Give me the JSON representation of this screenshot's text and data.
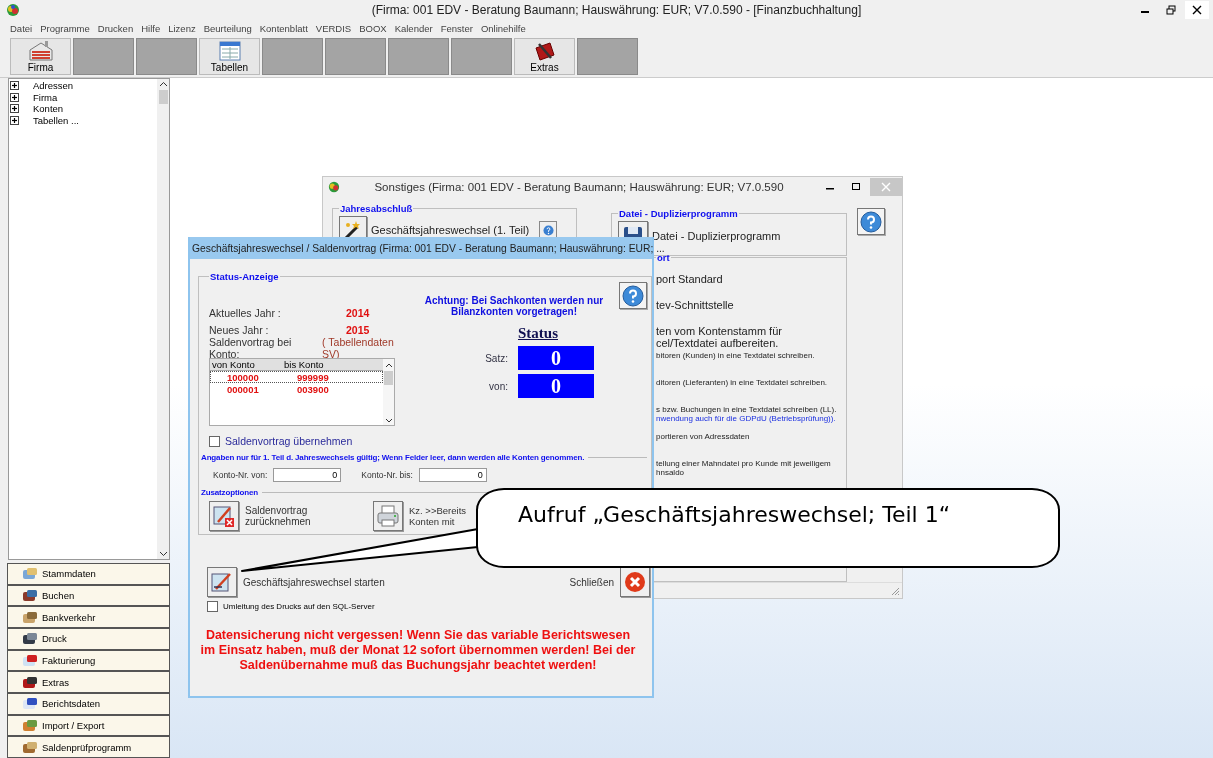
{
  "window": {
    "title": "(Firma: 001 EDV - Beratung Baumann;  Hauswährung: EUR; V7.0.590 - [Finanzbuchhaltung]"
  },
  "menu": [
    "Datei",
    "Programme",
    "Drucken",
    "Hilfe",
    "Lizenz",
    "Beurteilung",
    "Kontenblatt",
    "VERDIS",
    "BOOX",
    "Kalender",
    "Fenster",
    "Onlinehilfe"
  ],
  "toolbar": [
    {
      "kind": "firma",
      "label": "Firma"
    },
    {
      "kind": "empty"
    },
    {
      "kind": "empty"
    },
    {
      "kind": "tabellen",
      "label": "Tabellen"
    },
    {
      "kind": "empty"
    },
    {
      "kind": "empty"
    },
    {
      "kind": "empty"
    },
    {
      "kind": "empty"
    },
    {
      "kind": "extras",
      "label": "Extras"
    },
    {
      "kind": "empty"
    }
  ],
  "tree": [
    {
      "label": "Adressen",
      "expanded": false
    },
    {
      "label": "Firma",
      "expanded": false
    },
    {
      "label": "Konten",
      "expanded": false
    },
    {
      "label": "Tabellen ...",
      "expanded": false
    }
  ],
  "nav": [
    {
      "kind": "stammdaten",
      "label": "Stammdaten"
    },
    {
      "kind": "buchen",
      "label": "Buchen"
    },
    {
      "kind": "bank",
      "label": "Bankverkehr"
    },
    {
      "kind": "druck",
      "label": "Druck"
    },
    {
      "kind": "faktura",
      "label": "Fakturierung"
    },
    {
      "kind": "extras",
      "label": "Extras"
    },
    {
      "kind": "bericht",
      "label": "Berichtsdaten"
    },
    {
      "kind": "import",
      "label": "Import / Export"
    },
    {
      "kind": "salden",
      "label": "Saldenprüfprogramm"
    }
  ],
  "sonstiges": {
    "title": "Sonstiges  (Firma: 001 EDV - Beratung Baumann;  Hauswährung: EUR; V7.0.590",
    "year_group": {
      "title": "Jahresabschluß",
      "button": "Geschäftsjahreswechsel (1. Teil)"
    },
    "copy_group": {
      "title": "Datei - Duplizierprogramm",
      "button": "Datei - Duplizierprogramm"
    },
    "export_group": {
      "title": "ort",
      "items": [
        {
          "kind": "primary",
          "lines": [
            "port Standard"
          ]
        },
        {
          "kind": "primary",
          "lines": [
            "tev-Schnittstelle"
          ]
        },
        {
          "kind": "primary",
          "lines": [
            "ten vom Kontenstamm für",
            "cel/Textdatei aufbereiten."
          ]
        },
        {
          "kind": "secondary",
          "lines": [
            "bitoren (Kunden) in eine Textdatei schreiben."
          ]
        },
        {
          "kind": "secondary",
          "lines": [
            "ditoren (Lieferanten) in eine Textdatei schreiben."
          ]
        },
        {
          "kind": "secondary",
          "lines": [
            "s bzw. Buchungen in eine Textdatei schreiben (LL)."
          ],
          "note": "nwendung auch für die GDPdU (Betriebsprüfung))."
        },
        {
          "kind": "secondary",
          "lines": [
            "portieren von Adressdaten"
          ]
        },
        {
          "kind": "secondary",
          "lines": [
            "tellung einer Mahndatei pro Kunde mit jeweiligem",
            "hnsaldo"
          ]
        }
      ]
    }
  },
  "dialog": {
    "title": "Geschäftsjahreswechsel / Saldenvortrag  (Firma: 001 EDV - Beratung Baumann;   Hauswährung: EUR; ...",
    "status_group": "Status-Anzeige",
    "fields": [
      {
        "label": "Aktuelles Jahr :",
        "value": "2014"
      },
      {
        "label": "Neues Jahr :",
        "value": "2015"
      }
    ],
    "notice": [
      "Achtung: Bei Sachkonten werden nur",
      "Bilanzkonten vorgetragen!"
    ],
    "konto_label": "Saldenvortrag bei Konto:",
    "konto_source": "( Tabellendaten SV)",
    "list": {
      "columns": [
        "von Konto",
        "bis Konto"
      ],
      "rows": [
        {
          "cells": [
            "100000",
            "999999"
          ],
          "selected": true
        },
        {
          "cells": [
            "000001",
            "003900"
          ],
          "selected": false
        }
      ]
    },
    "status": {
      "heading": "Status",
      "rows": [
        {
          "label": "Satz:",
          "value": "0"
        },
        {
          "label": "von:",
          "value": "0"
        }
      ]
    },
    "carry_checkbox": {
      "label": "Saldenvortrag übernehmen",
      "checked": false
    },
    "range_heading": "Angaben nur für 1. Teil d. Jahreswechsels gültig; Wenn Felder leer, dann werden alle Konten genommen.",
    "range_fields": [
      {
        "label": "Konto-Nr. von:",
        "value": "0"
      },
      {
        "label": "Konto-Nr. bis:",
        "value": "0"
      }
    ],
    "options_heading": "Zusatzoptionen",
    "options": [
      {
        "kind": "undo",
        "lines": [
          "Saldenvortrag",
          "zurücknehmen"
        ]
      },
      {
        "kind": "print",
        "lines": [
          "Kz. >>Bereits",
          "Konten mit"
        ]
      }
    ],
    "start_button": "Geschäftsjahreswechsel starten",
    "close_label": "Schließen",
    "sql_checkbox": {
      "label": "Umleitung des Drucks auf den SQL-Server",
      "checked": false
    },
    "warning": "Datensicherung nicht vergessen! Wenn Sie das variable Berichtswesen im Einsatz haben, muß der Monat 12 sofort übernommen werden! Bei der Saldenübernahme muß das Buchungsjahr beachtet werden!"
  },
  "callout": {
    "text": "Aufruf „Geschäftsjahreswechsel; Teil 1“"
  }
}
